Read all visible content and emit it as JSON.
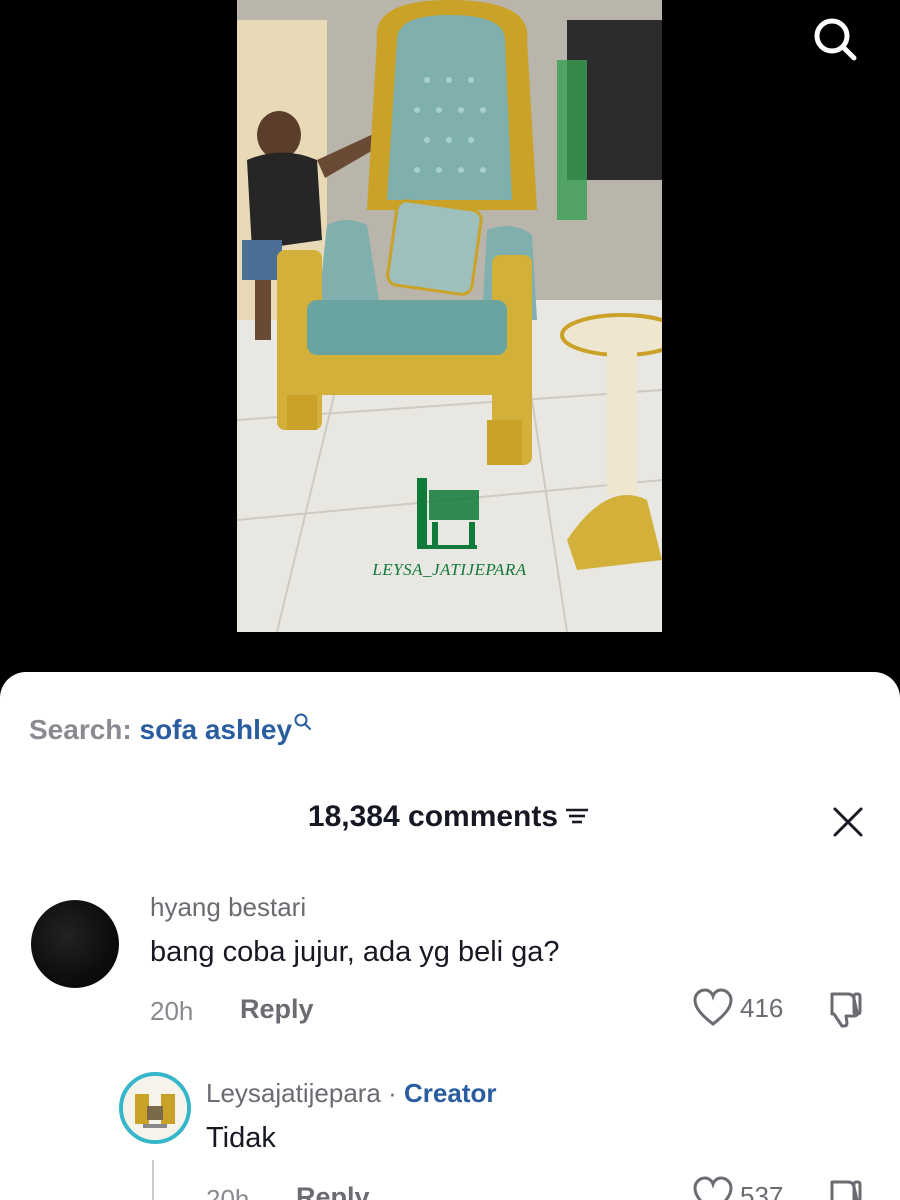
{
  "video": {
    "watermark": "LEYSA_JATIJEPARA",
    "search_icon": "search-icon"
  },
  "colors": {
    "accent_blue": "#2a5d9f",
    "text_dark": "#161823",
    "text_muted": "#8a8b91",
    "creator_ring": "#36b7c9",
    "chair_velvet": "#7fb0ad",
    "gold": "#c9a227"
  },
  "search_suggestion": {
    "prefix": "Search:",
    "term": "sofa ashley"
  },
  "comments_header": {
    "count_label": "18,384 comments",
    "sort_icon": "sort-icon",
    "close_icon": "close-icon"
  },
  "comments": [
    {
      "username": "hyang bestari",
      "text": "bang coba jujur, ada yg beli ga?",
      "time": "20h",
      "reply_label": "Reply",
      "likes": "416"
    },
    {
      "username": "Leysajatijepara",
      "separator": "·",
      "badge": "Creator",
      "text": "Tidak",
      "time": "20h",
      "reply_label": "Reply",
      "likes": "537"
    }
  ]
}
